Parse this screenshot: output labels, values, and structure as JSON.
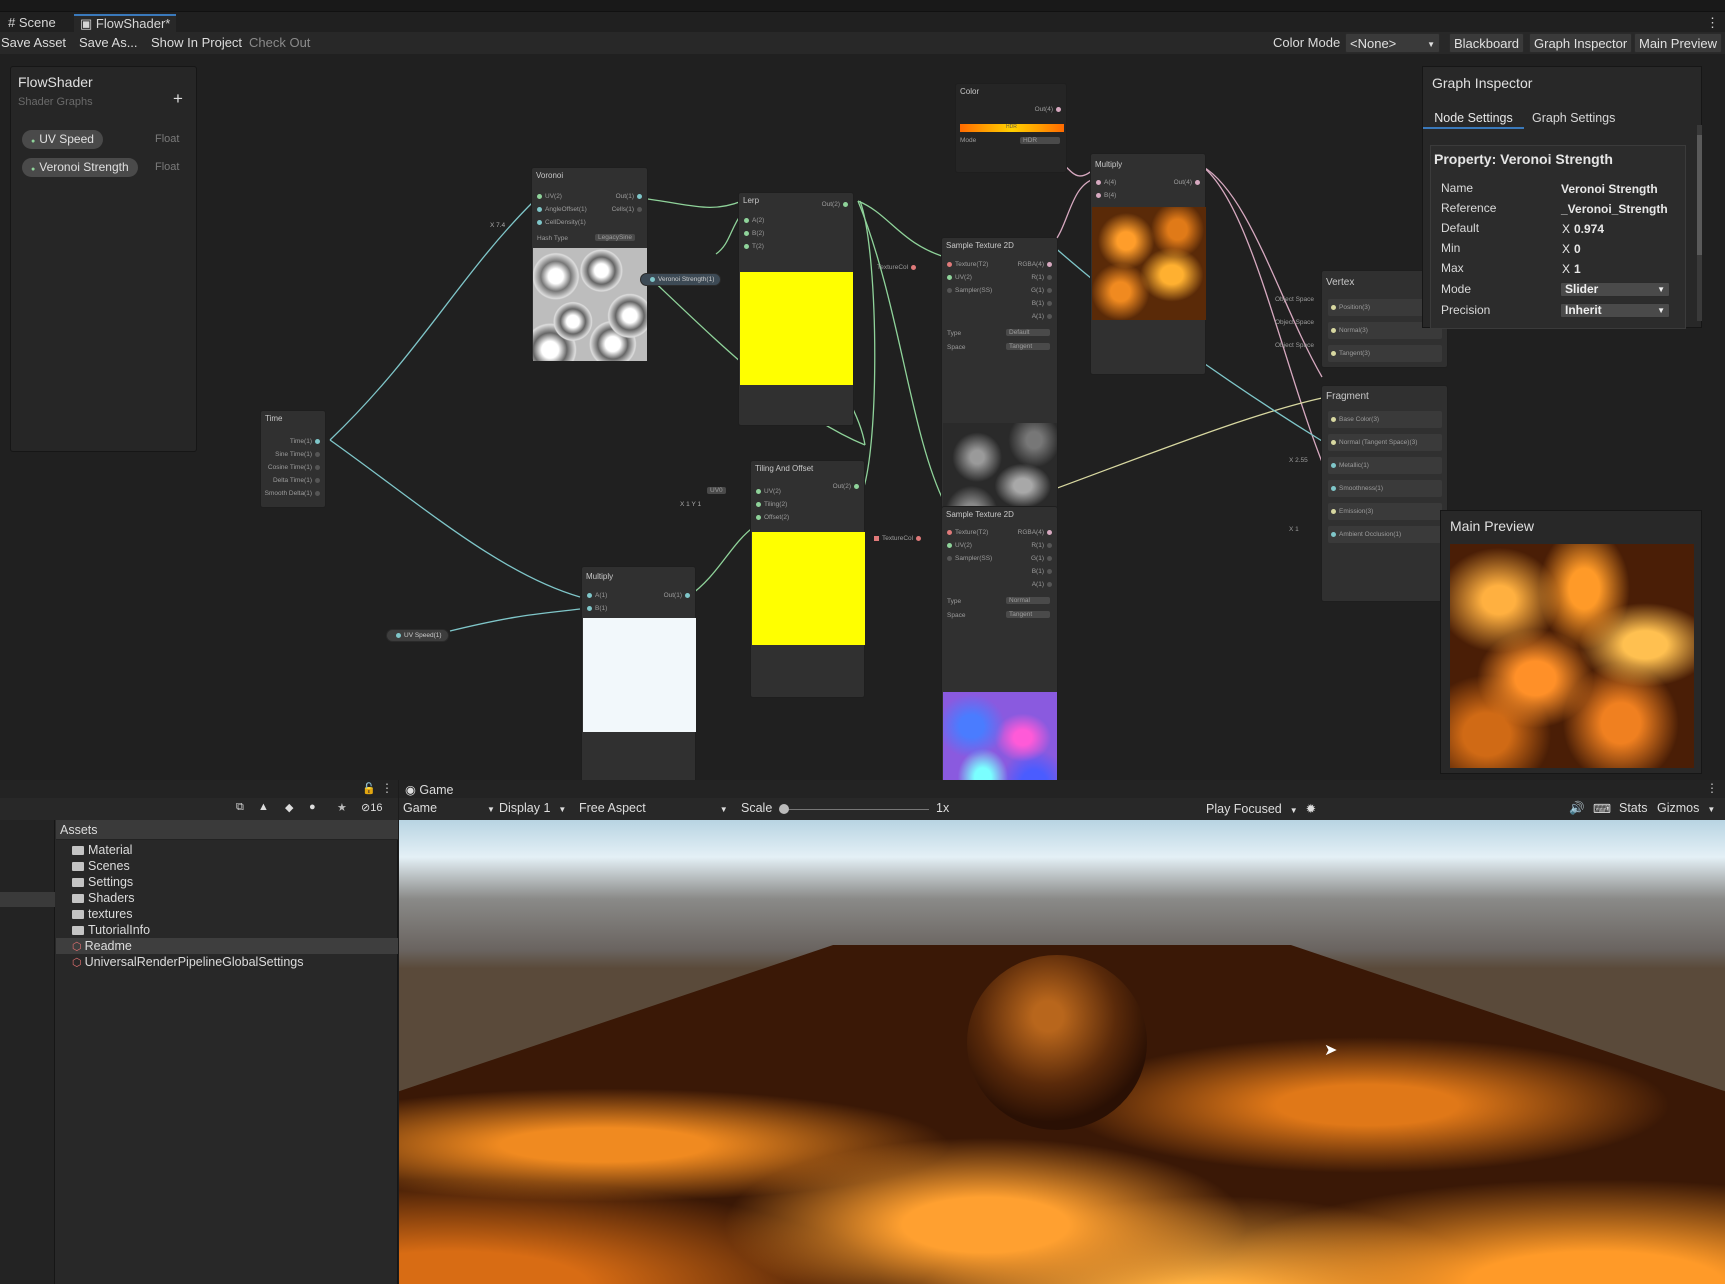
{
  "tabs": {
    "scene": "Scene",
    "flowshader": "FlowShader*",
    "game": "Game"
  },
  "toolbar": {
    "save_asset": "Save Asset",
    "save_as": "Save As...",
    "show_in_project": "Show In Project",
    "check_out": "Check Out",
    "color_mode_label": "Color Mode",
    "color_mode_value": "<None>",
    "blackboard": "Blackboard",
    "graph_inspector": "Graph Inspector",
    "main_preview": "Main Preview"
  },
  "blackboard": {
    "title": "FlowShader",
    "subtitle": "Shader Graphs",
    "add": "+",
    "properties": [
      {
        "name": "UV Speed",
        "type": "Float"
      },
      {
        "name": "Veronoi Strength",
        "type": "Float"
      }
    ]
  },
  "nodes": {
    "voronoi": {
      "title": "Voronoi",
      "in": [
        "UV(2)",
        "AngleOffset(1)",
        "CellDensity(1)"
      ],
      "out": [
        "Out(1)",
        "Cells(1)"
      ],
      "hash_label": "Hash Type",
      "hash_value": "LegacySine",
      "x_value": "X 7.4"
    },
    "lerp": {
      "title": "Lerp",
      "in": [
        "A(2)",
        "B(2)",
        "T(2)"
      ],
      "out": "Out(2)"
    },
    "veronoi_prop": "Veronoi Strength(1)",
    "time": {
      "title": "Time",
      "out": [
        "Time(1)",
        "Sine Time(1)",
        "Cosine Time(1)",
        "Delta Time(1)",
        "Smooth Delta(1)"
      ]
    },
    "tiling": {
      "title": "Tiling And Offset",
      "in": [
        "UV(2)",
        "Tiling(2)",
        "Offset(2)"
      ],
      "out": "Out(2)",
      "uv_value": "UV0",
      "xy_value": "X 1    Y 1"
    },
    "multiply_bottom": {
      "title": "Multiply",
      "in": [
        "A(1)",
        "B(1)"
      ],
      "out": "Out(1)"
    },
    "uvspeed_prop": "UV Speed(1)",
    "color": {
      "title": "Color",
      "out": "Out(4)",
      "mode_label": "Mode",
      "mode_value": "HDR",
      "hdr_tag": "HDR"
    },
    "multiply_top": {
      "title": "Multiply",
      "in": [
        "A(4)",
        "B(4)"
      ],
      "out": "Out(4)"
    },
    "sample1": {
      "title": "Sample Texture 2D",
      "in": [
        "Texture(T2)",
        "UV(2)",
        "Sampler(SS)"
      ],
      "out": [
        "RGBA(4)",
        "R(1)",
        "G(1)",
        "B(1)",
        "A(1)"
      ],
      "type_label": "Type",
      "type_value": "Default",
      "space_label": "Space",
      "space_value": "Tangent",
      "tex_label": "TextureCol"
    },
    "sample2": {
      "title": "Sample Texture 2D",
      "in": [
        "Texture(T2)",
        "UV(2)",
        "Sampler(SS)"
      ],
      "out": [
        "RGBA(4)",
        "R(1)",
        "G(1)",
        "B(1)",
        "A(1)"
      ],
      "type_label": "Type",
      "type_value": "Normal",
      "space_label": "Space",
      "space_value": "Tangent",
      "tex_label": "TextureCol"
    },
    "vertex": {
      "title": "Vertex",
      "ports": [
        "Position(3)",
        "Normal(3)",
        "Tangent(3)"
      ],
      "space": "Object Space"
    },
    "fragment": {
      "title": "Fragment",
      "ports": [
        "Base Color(3)",
        "Normal (Tangent Space)(3)",
        "Metallic(1)",
        "Smoothness(1)",
        "Emission(3)",
        "Ambient Occlusion(1)"
      ],
      "metallic_value": "X 2.55",
      "ao_value": "X 1"
    }
  },
  "inspector": {
    "title": "Graph Inspector",
    "tab_node": "Node Settings",
    "tab_graph": "Graph Settings",
    "property_title": "Property: Veronoi Strength",
    "rows": [
      {
        "label": "Name",
        "value": "Veronoi Strength"
      },
      {
        "label": "Reference",
        "value": "_Veronoi_Strength"
      },
      {
        "label": "Default",
        "value": "0.974"
      },
      {
        "label": "Min",
        "value": "0"
      },
      {
        "label": "Max",
        "value": "1"
      },
      {
        "label": "Mode",
        "value": "Slider"
      },
      {
        "label": "Precision",
        "value": "Inherit"
      }
    ],
    "x_label": "X"
  },
  "main_preview": {
    "title": "Main Preview"
  },
  "project": {
    "hidden_count": "16",
    "assets_label": "Assets",
    "items": [
      {
        "name": "Material",
        "kind": "folder"
      },
      {
        "name": "Scenes",
        "kind": "folder"
      },
      {
        "name": "Settings",
        "kind": "folder"
      },
      {
        "name": "Shaders",
        "kind": "folder"
      },
      {
        "name": "textures",
        "kind": "folder"
      },
      {
        "name": "TutorialInfo",
        "kind": "folder"
      },
      {
        "name": "Readme",
        "kind": "asset"
      },
      {
        "name": "UniversalRenderPipelineGlobalSettings",
        "kind": "asset"
      }
    ]
  },
  "game": {
    "mode": "Game",
    "display": "Display 1",
    "aspect": "Free Aspect",
    "scale_label": "Scale",
    "scale_value": "1x",
    "play_focused": "Play Focused",
    "stats": "Stats",
    "gizmos": "Gizmos"
  },
  "colors": {
    "accent": "#3a79bb",
    "yellow": "#ffff00",
    "background": "#202020"
  }
}
